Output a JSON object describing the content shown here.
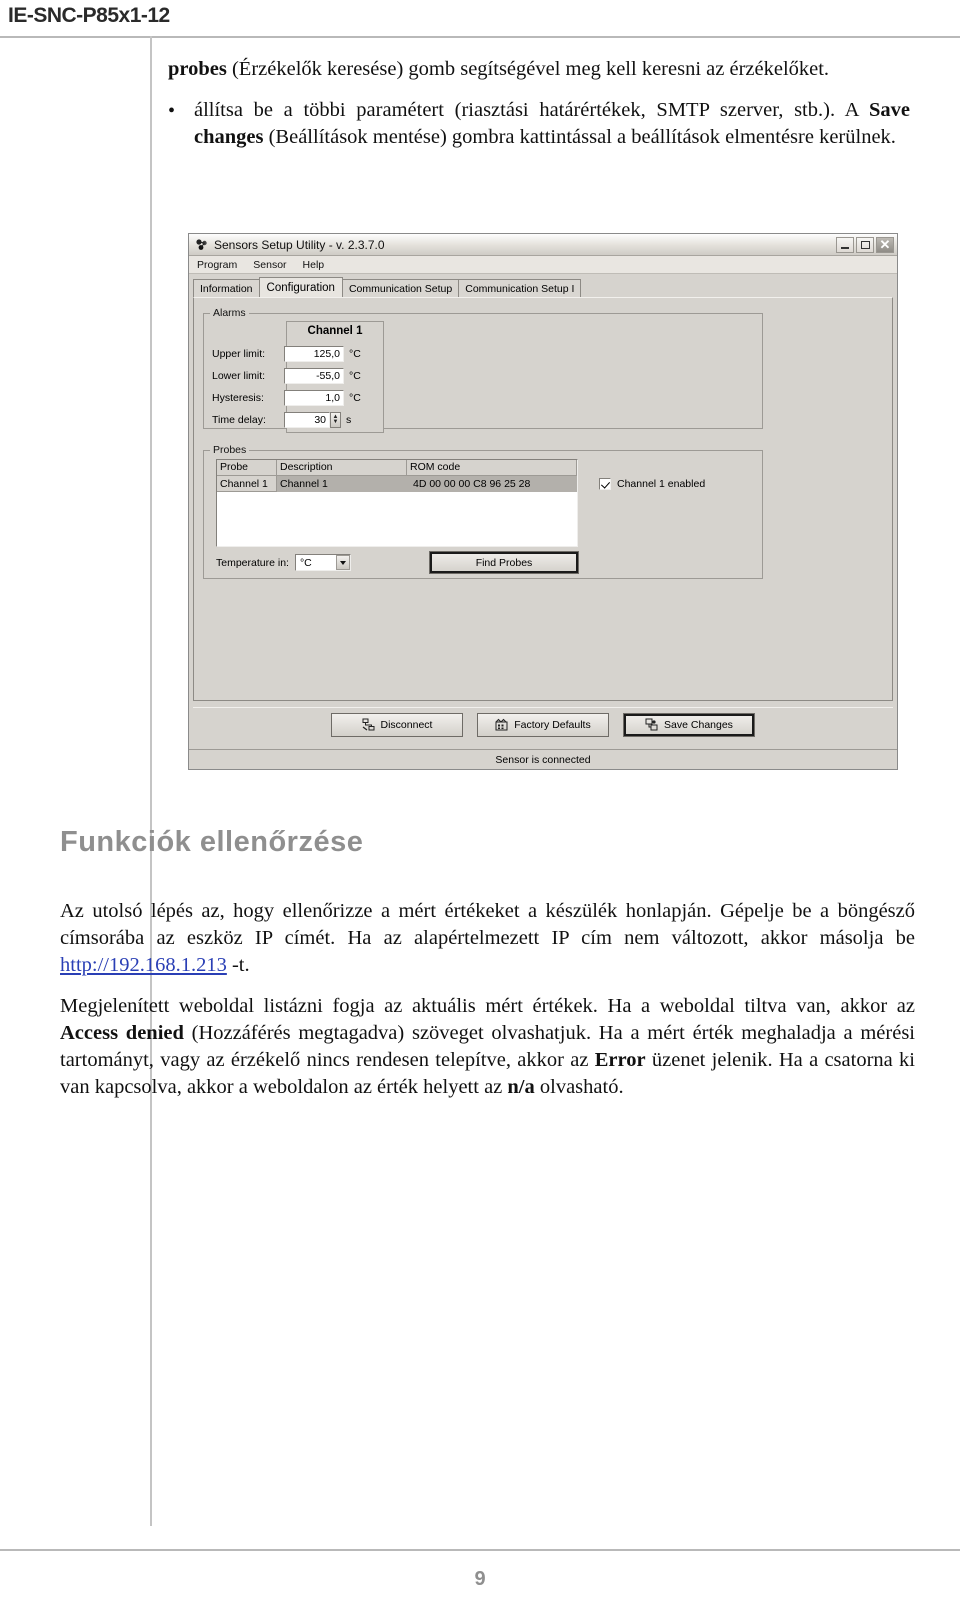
{
  "document": {
    "running_header": "IE-SNC-P85x1-12",
    "page_number": "9"
  },
  "intro": {
    "para1_bold": "probes",
    "para1_rest": " (Érzékelők keresése) gomb segítségével meg kell keresni az érzékelőket.",
    "bullet_marker": "•",
    "bullet_part1": "állítsa be a többi paramétert (riasztási határértékek, SMTP szerver, stb.). A ",
    "bullet_bold": "Save changes",
    "bullet_part2": " (Beállítások mentése) gombra kattintással a beállítások elmentésre kerülnek."
  },
  "app": {
    "title": "Sensors Setup Utility - v. 2.3.7.0",
    "title_icon": "sensors-app-icon",
    "window_buttons": {
      "minimize": "minimize-icon",
      "maximize": "maximize-icon",
      "close": "close-icon"
    },
    "menu": [
      "Program",
      "Sensor",
      "Help"
    ],
    "tabs": [
      {
        "label": "Information",
        "active": false
      },
      {
        "label": "Configuration",
        "active": true
      },
      {
        "label": "Communication Setup",
        "active": false
      },
      {
        "label": "Communication Setup I",
        "active": false
      }
    ],
    "alarms": {
      "legend": "Alarms",
      "channel_header": "Channel 1",
      "rows": [
        {
          "label": "Upper limit:",
          "value": "125,0",
          "unit": "°C"
        },
        {
          "label": "Lower limit:",
          "value": "-55,0",
          "unit": "°C"
        },
        {
          "label": "Hysteresis:",
          "value": "1,0",
          "unit": "°C"
        },
        {
          "label": "Time delay:",
          "value": "30",
          "unit": "s"
        }
      ],
      "spinner_up": "▲",
      "spinner_down": "▼"
    },
    "probes": {
      "legend": "Probes",
      "columns": [
        "Probe",
        "Description",
        "ROM code"
      ],
      "rows": [
        {
          "probe": "Channel 1",
          "description": "Channel 1",
          "rom_code": "4D 00 00 00 C8 96 25 28"
        }
      ],
      "checkbox_label": "Channel 1 enabled",
      "checkbox_checked": true,
      "temperature_label": "Temperature in:",
      "temperature_value": "°C",
      "find_probes_label": "Find Probes"
    },
    "buttons": [
      {
        "label": "Disconnect",
        "icon": "disconnect-icon",
        "focused": false
      },
      {
        "label": "Factory Defaults",
        "icon": "factory-defaults-icon",
        "focused": false
      },
      {
        "label": "Save Changes",
        "icon": "save-changes-icon",
        "focused": true
      }
    ],
    "status": "Sensor is connected"
  },
  "section": {
    "heading": "Funkciók ellenőrzése",
    "p1_a": "Az utolsó lépés az, hogy ellenőrizze a mért értékeket a készülék honlapján. Gépelje be a böngésző címsorába az eszköz IP címét. Ha az alapértelmezett IP cím nem változott, akkor másolja be ",
    "p1_link": "http://192.168.1.213",
    "p1_b": " -t.",
    "p2_a": "Megjelenített weboldal listázni fogja az aktuális mért értékek. Ha a weboldal tiltva van, akkor az ",
    "p2_bold1": "Access denied",
    "p2_b": " (Hozzáférés megtagadva) szöveget olvashatjuk. Ha a mért érték meghaladja a mérési tartományt, vagy az érzékelő nincs rendesen telepítve, akkor az ",
    "p2_bold2": "Error",
    "p2_c": " üzenet jelenik. Ha a csatorna ki van kapcsolva, akkor a weboldalon az érték helyett az ",
    "p2_bold3": "n/a",
    "p2_d": " olvasható."
  },
  "colors": {
    "heading_gray": "#8f8f8f",
    "link_blue": "#2a3fb5",
    "window_face": "#d6d3ce",
    "selected_row": "#b3b0ab"
  }
}
